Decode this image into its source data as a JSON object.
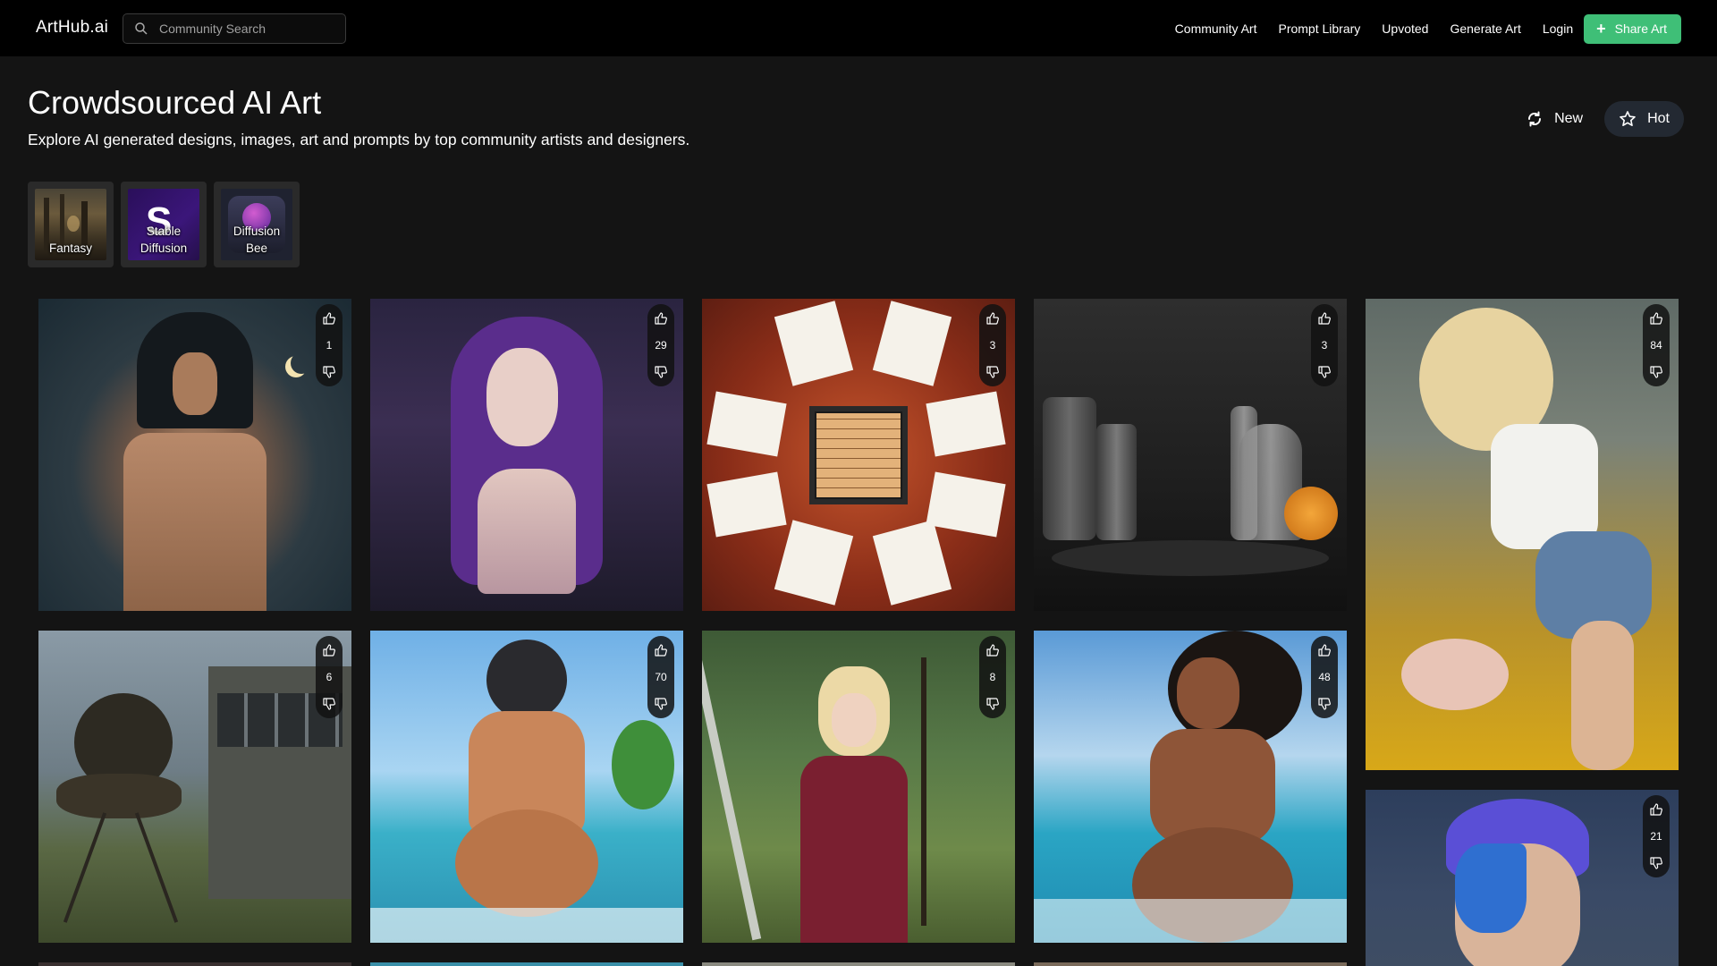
{
  "nav": {
    "logo": "ArtHub.ai",
    "search_placeholder": "Community Search",
    "links": [
      "Community Art",
      "Prompt Library",
      "Upvoted",
      "Generate Art",
      "Login"
    ],
    "share_label": "Share Art",
    "accent": "#3fbf77"
  },
  "header": {
    "title": "Crowdsourced AI Art",
    "subtitle": "Explore AI generated designs, images, art and prompts by top community artists and designers.",
    "sort_new": "New",
    "sort_hot": "Hot",
    "active_sort": "Hot"
  },
  "categories": [
    {
      "label": "Fantasy"
    },
    {
      "label": "Stable Diffusion"
    },
    {
      "label": "Diffusion Bee"
    }
  ],
  "cards": [
    {
      "votes": "1"
    },
    {
      "votes": "29"
    },
    {
      "votes": "3"
    },
    {
      "votes": "3"
    },
    {
      "votes": "84"
    },
    {
      "votes": "6"
    },
    {
      "votes": "70"
    },
    {
      "votes": "8"
    },
    {
      "votes": "48"
    },
    {
      "votes": "21"
    }
  ]
}
